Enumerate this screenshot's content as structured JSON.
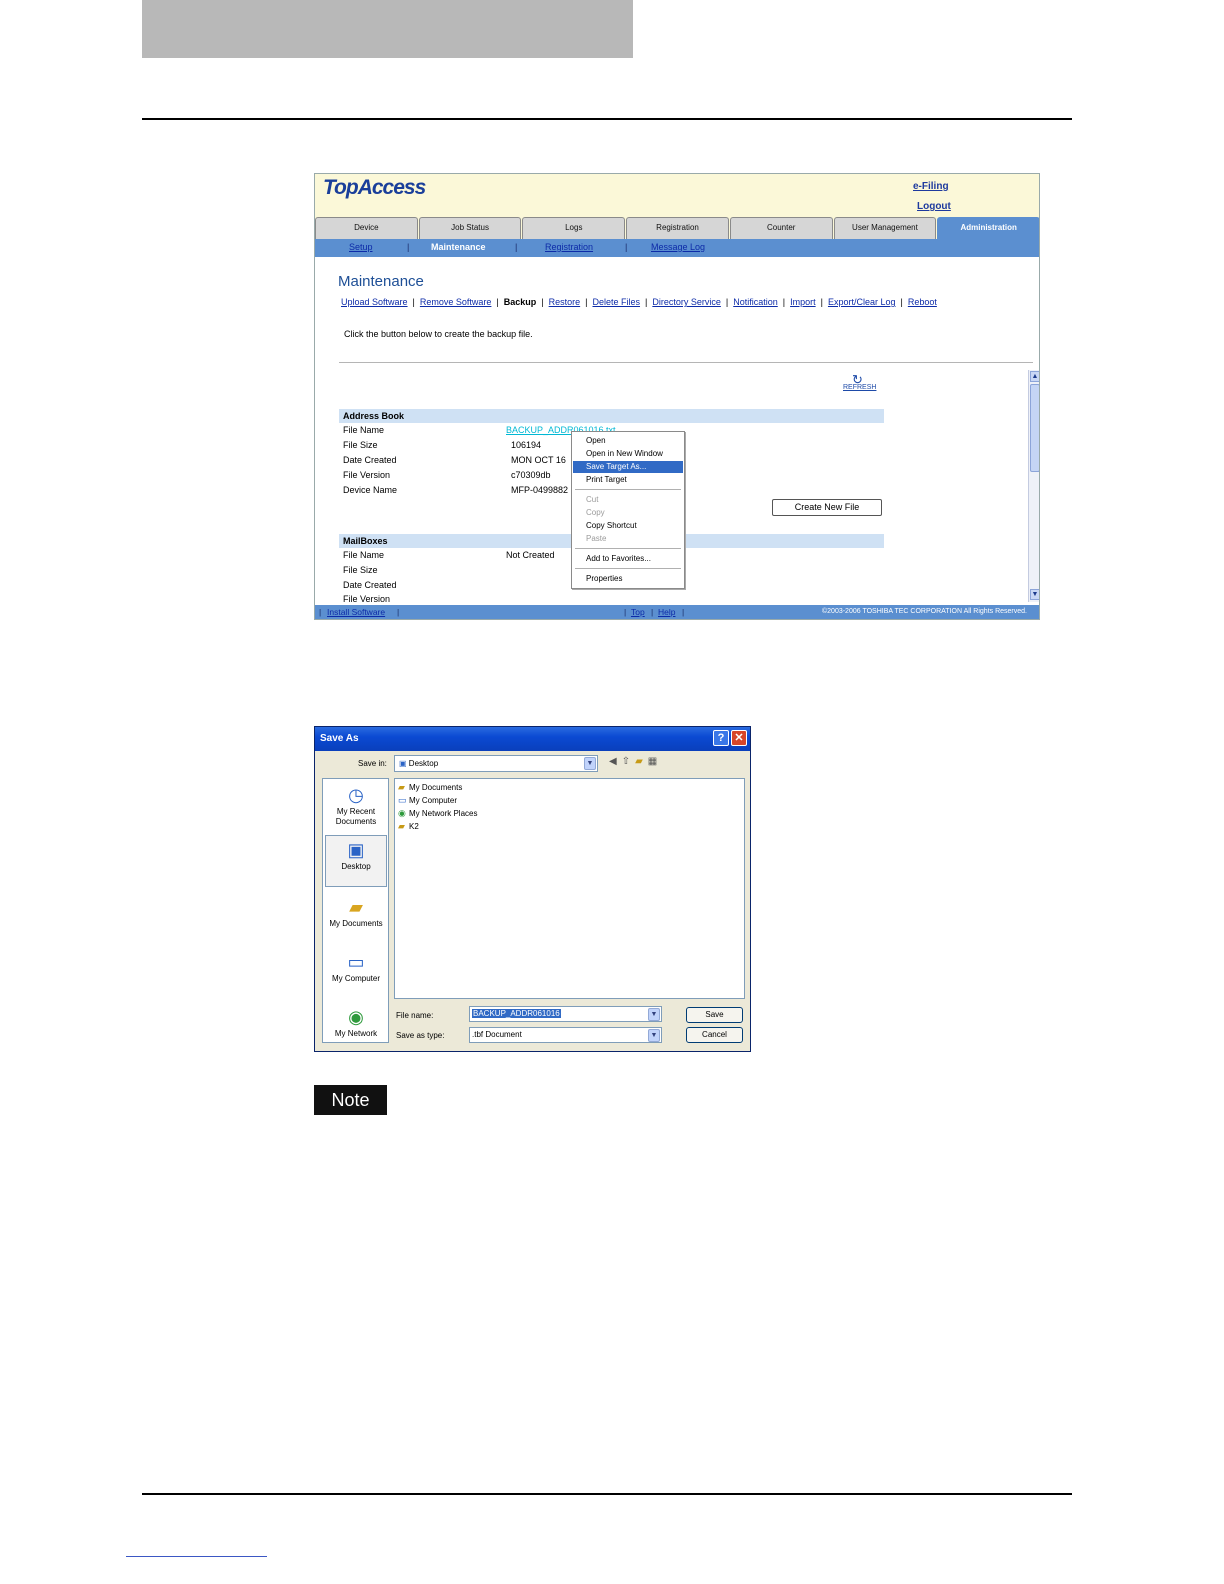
{
  "topaccess": {
    "logo": "TopAccess",
    "efiling": "e-Filing",
    "logout": "Logout",
    "tabs": [
      "Device",
      "Job Status",
      "Logs",
      "Registration",
      "Counter",
      "User Management",
      "Administration"
    ],
    "active_tab": "Administration",
    "subnav": {
      "setup": "Setup",
      "maintenance": "Maintenance",
      "registration": "Registration",
      "message_log": "Message Log"
    },
    "title": "Maintenance",
    "maint_nav": [
      "Upload Software",
      "Remove Software",
      "Backup",
      "Restore",
      "Delete Files",
      "Directory Service",
      "Notification",
      "Import",
      "Export/Clear Log",
      "Reboot"
    ],
    "instruction": "Click the button below to create the backup file.",
    "refresh": "REFRESH",
    "address_book": {
      "heading": "Address Book",
      "labels": [
        "File Name",
        "File Size",
        "Date Created",
        "File Version",
        "Device Name"
      ],
      "file_name": "BACKUP_ADDR061016.txt",
      "file_size": "106194",
      "date_created": "MON OCT 16",
      "file_version": "c70309db",
      "device_name": "MFP-0499882"
    },
    "create_button": "Create New File",
    "mailboxes": {
      "heading": "MailBoxes",
      "labels": [
        "File Name",
        "File Size",
        "Date Created",
        "File Version"
      ],
      "file_name": "Not Created"
    },
    "context_menu": {
      "open": "Open",
      "open_new": "Open in New Window",
      "save_target": "Save Target As...",
      "print_target": "Print Target",
      "cut": "Cut",
      "copy": "Copy",
      "copy_shortcut": "Copy Shortcut",
      "paste": "Paste",
      "add_favorites": "Add to Favorites...",
      "properties": "Properties"
    },
    "footer": {
      "install": "Install Software",
      "top": "Top",
      "help": "Help",
      "copyright": "©2003-2006 TOSHIBA TEC CORPORATION All Rights Reserved."
    }
  },
  "save_as": {
    "title": "Save As",
    "help_glyph": "?",
    "close_glyph": "✕",
    "save_in_label": "Save in:",
    "save_in_value": "Desktop",
    "places": [
      "My Recent Documents",
      "Desktop",
      "My Documents",
      "My Computer",
      "My Network"
    ],
    "selected_place": "Desktop",
    "files": [
      "My Documents",
      "My Computer",
      "My Network Places",
      "K2"
    ],
    "file_name_label": "File name:",
    "file_name_value": "BACKUP_ADDR061016",
    "save_type_label": "Save as type:",
    "save_type_value": ".tbf Document",
    "save_button": "Save",
    "cancel_button": "Cancel"
  },
  "note_label": "Note"
}
